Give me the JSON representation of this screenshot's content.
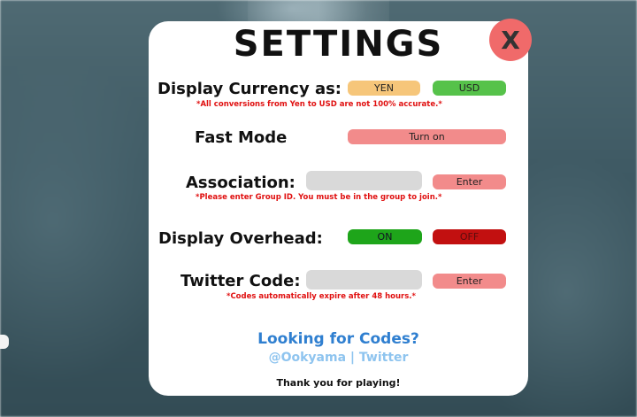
{
  "settings": {
    "title": "SETTINGS",
    "close_label": "X",
    "currency": {
      "label": "Display Currency as:",
      "yen_label": "YEN",
      "usd_label": "USD",
      "note": "*All conversions from Yen to USD are not 100% accurate.*"
    },
    "fast_mode": {
      "label": "Fast Mode",
      "button_label": "Turn on"
    },
    "association": {
      "label": "Association:",
      "input_value": "",
      "button_label": "Enter",
      "note": "*Please enter Group ID. You must be in the group to join.*"
    },
    "overhead": {
      "label": "Display Overhead:",
      "on_label": "ON",
      "off_label": "OFF"
    },
    "twitter": {
      "label": "Twitter Code:",
      "input_value": "",
      "button_label": "Enter",
      "note": "*Codes automatically expire after 48 hours.*"
    },
    "codes": {
      "title": "Looking for Codes?",
      "subtitle": "@Ookyama | Twitter"
    },
    "thanks": "Thank you for playing!"
  },
  "colors": {
    "close": "#f06a6a",
    "yen": "#f6c67a",
    "usd": "#56c24a",
    "pink_button": "#f28b8b",
    "on": "#1ea51a",
    "off": "#c21010",
    "note_red": "#e01010",
    "link_blue": "#2f7fd0"
  },
  "icons": {
    "close": "close-icon"
  }
}
